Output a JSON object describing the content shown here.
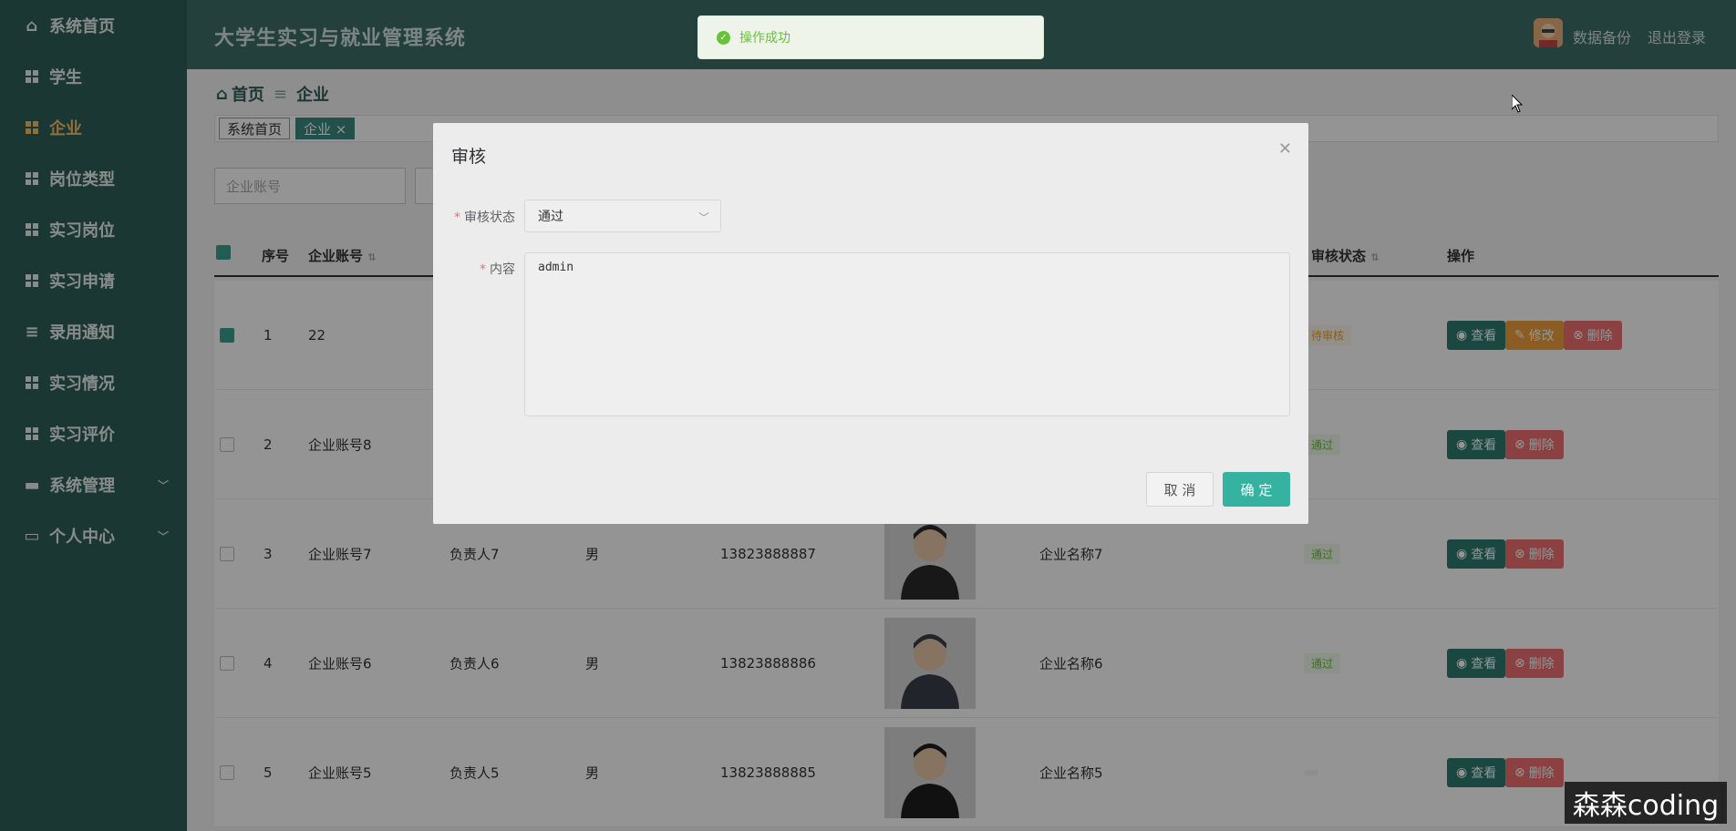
{
  "sidebar": {
    "items": [
      {
        "label": "系统首页",
        "icon": "home-icon"
      },
      {
        "label": "学生",
        "icon": "grid-icon"
      },
      {
        "label": "企业",
        "icon": "grid-icon",
        "active": true
      },
      {
        "label": "岗位类型",
        "icon": "grid-icon"
      },
      {
        "label": "实习岗位",
        "icon": "grid-icon"
      },
      {
        "label": "实习申请",
        "icon": "grid-icon"
      },
      {
        "label": "录用通知",
        "icon": "list-icon"
      },
      {
        "label": "实习情况",
        "icon": "grid-icon"
      },
      {
        "label": "实习评价",
        "icon": "grid-icon"
      },
      {
        "label": "系统管理",
        "icon": "briefcase-icon",
        "expandable": true
      },
      {
        "label": "个人中心",
        "icon": "card-icon",
        "expandable": true
      }
    ]
  },
  "header": {
    "title": "大学生实习与就业管理系统",
    "backup": "数据备份",
    "logout": "退出登录"
  },
  "breadcrumb": {
    "home": "首页",
    "current": "企业"
  },
  "tags": [
    {
      "label": "系统首页"
    },
    {
      "label": "企业 ×"
    }
  ],
  "search": {
    "placeholder": "企业账号"
  },
  "table": {
    "headers": {
      "index": "序号",
      "account": "企业账号",
      "status": "审核状态",
      "actions": "操作"
    },
    "rows": [
      {
        "index": "1",
        "account": "22",
        "person": "",
        "gender": "",
        "phone": "",
        "company": "",
        "status": "待审核",
        "status_type": "pending",
        "checked": true,
        "edit": true
      },
      {
        "index": "2",
        "account": "企业账号8",
        "person": "",
        "gender": "",
        "phone": "",
        "company": "",
        "status": "通过",
        "status_type": "pass",
        "checked": false,
        "edit": false
      },
      {
        "index": "3",
        "account": "企业账号7",
        "person": "负责人7",
        "gender": "男",
        "phone": "13823888887",
        "company": "企业名称7",
        "status": "通过",
        "status_type": "pass",
        "checked": false,
        "edit": false
      },
      {
        "index": "4",
        "account": "企业账号6",
        "person": "负责人6",
        "gender": "男",
        "phone": "13823888886",
        "company": "企业名称6",
        "status": "通过",
        "status_type": "pass",
        "checked": false,
        "edit": false
      },
      {
        "index": "5",
        "account": "企业账号5",
        "person": "负责人5",
        "gender": "男",
        "phone": "13823888885",
        "company": "企业名称5",
        "status": "",
        "status_type": "pass",
        "checked": false,
        "edit": false
      }
    ],
    "btn_view": "查看",
    "btn_edit": "修改",
    "btn_delete": "删除"
  },
  "dialog": {
    "title": "审核",
    "status_label": "审核状态",
    "status_value": "通过",
    "content_label": "内容",
    "content_value": "admin",
    "cancel": "取 消",
    "confirm": "确 定"
  },
  "toast": {
    "message": "操作成功"
  },
  "watermark": "森森coding",
  "colors": {
    "sidebar": "#2f5f5a",
    "accent": "#36b3a0",
    "active": "#f5c16c"
  }
}
